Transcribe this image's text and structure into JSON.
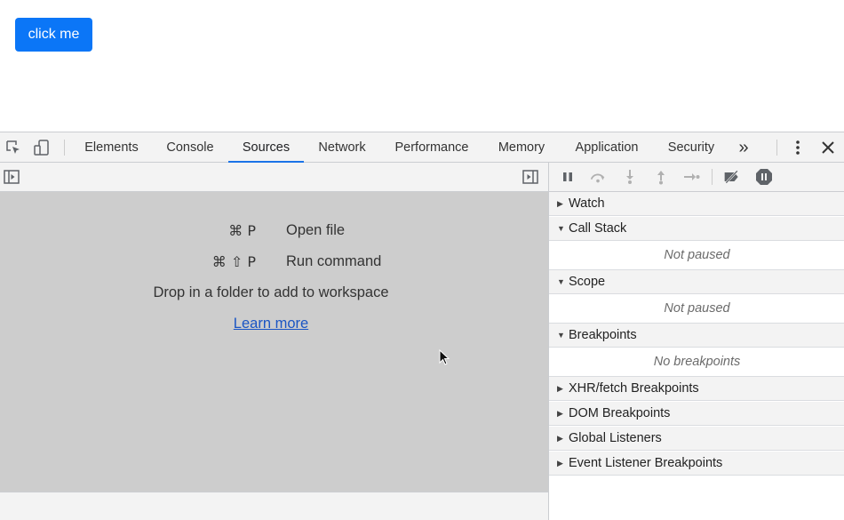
{
  "page": {
    "button_label": "click me"
  },
  "devtools": {
    "tabs": [
      {
        "label": "Elements"
      },
      {
        "label": "Console"
      },
      {
        "label": "Sources"
      },
      {
        "label": "Network"
      },
      {
        "label": "Performance"
      },
      {
        "label": "Memory"
      },
      {
        "label": "Application"
      },
      {
        "label": "Security"
      }
    ],
    "active_tab": "Sources",
    "more_tabs_glyph": "»",
    "accent_color": "#1a73e8"
  },
  "sources": {
    "shortcuts": [
      {
        "keys": "⌘ P",
        "label": "Open file"
      },
      {
        "keys": "⌘ ⇧ P",
        "label": "Run command"
      }
    ],
    "drop_text": "Drop in a folder to add to workspace",
    "learn_more": "Learn more"
  },
  "debugger": {
    "sections": [
      {
        "title": "Watch",
        "expanded": false
      },
      {
        "title": "Call Stack",
        "expanded": true,
        "body": "Not paused"
      },
      {
        "title": "Scope",
        "expanded": true,
        "body": "Not paused"
      },
      {
        "title": "Breakpoints",
        "expanded": true,
        "body": "No breakpoints"
      },
      {
        "title": "XHR/fetch Breakpoints",
        "expanded": false
      },
      {
        "title": "DOM Breakpoints",
        "expanded": false
      },
      {
        "title": "Global Listeners",
        "expanded": false
      },
      {
        "title": "Event Listener Breakpoints",
        "expanded": false
      }
    ]
  }
}
